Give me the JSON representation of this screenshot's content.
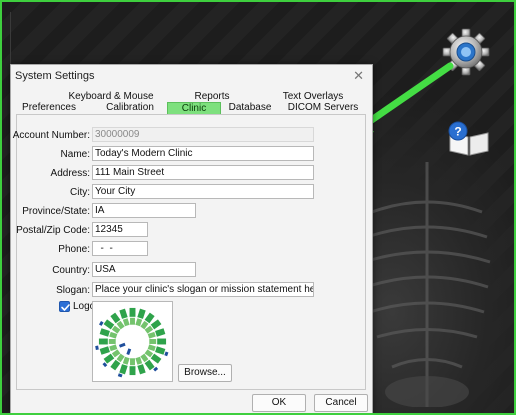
{
  "dialog": {
    "title": "System Settings",
    "tabs_row1": [
      {
        "id": "keyboard",
        "label": "Keyboard & Mouse"
      },
      {
        "id": "reports",
        "label": "Reports"
      },
      {
        "id": "overlays",
        "label": "Text Overlays"
      }
    ],
    "tabs_row2": [
      {
        "id": "preferences",
        "label": "Preferences"
      },
      {
        "id": "calibration",
        "label": "Calibration"
      },
      {
        "id": "clinic",
        "label": "Clinic",
        "active": true
      },
      {
        "id": "database",
        "label": "Database"
      },
      {
        "id": "dicom",
        "label": "DICOM Servers"
      }
    ],
    "fields": {
      "account_number": {
        "label": "Account Number:",
        "value": "30000009"
      },
      "name": {
        "label": "Name:",
        "value": "Today's Modern Clinic"
      },
      "address": {
        "label": "Address:",
        "value": "111 Main Street"
      },
      "city": {
        "label": "City:",
        "value": "Your City"
      },
      "province": {
        "label": "Province/State:",
        "value": "IA"
      },
      "postal": {
        "label": "Postal/Zip Code:",
        "value": "12345"
      },
      "phone": {
        "label": "Phone:",
        "value": "  -  -"
      },
      "country": {
        "label": "Country:",
        "value": "USA"
      },
      "slogan": {
        "label": "Slogan:",
        "value": "Place your clinic's slogan or mission statement here!"
      }
    },
    "logo": {
      "label": "Logo:",
      "checked": true
    },
    "browse_label": "Browse...",
    "ok_label": "OK",
    "cancel_label": "Cancel"
  },
  "colors": {
    "accent_green": "#3ecf3e",
    "active_tab": "#7ee07e",
    "checkbox": "#2b6fd6"
  },
  "icons": [
    "gear-icon",
    "help-book-icon",
    "green-arrow",
    "clinic-logo-icon",
    "close-icon",
    "checkmark-icon"
  ]
}
